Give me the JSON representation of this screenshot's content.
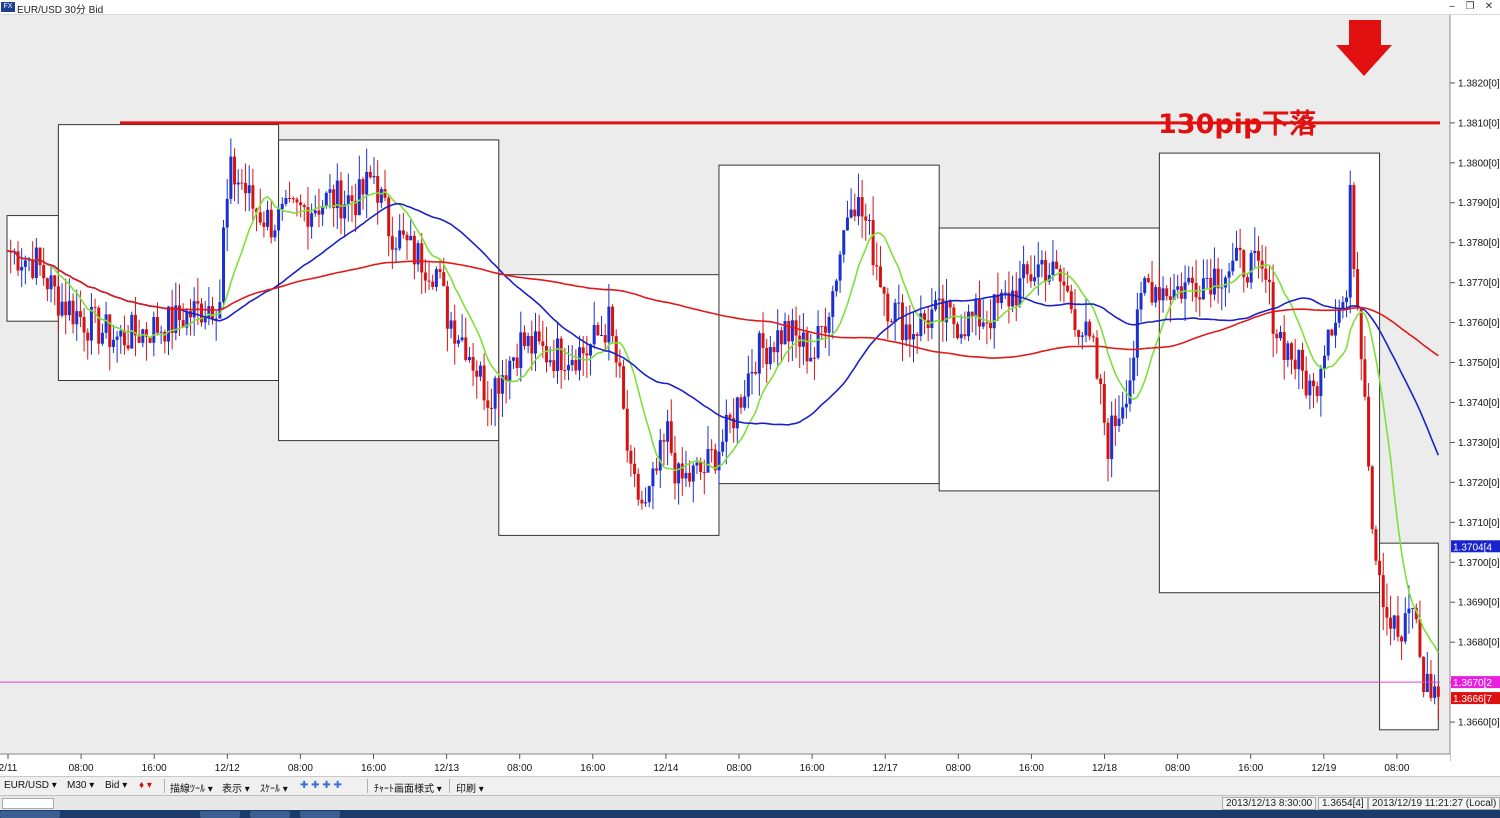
{
  "window": {
    "title": "EUR/USD 30分 Bid",
    "icon_label": "FX",
    "buttons": [
      {
        "name": "minimize-icon",
        "glyph": "–"
      },
      {
        "name": "restore-icon",
        "glyph": "❐"
      },
      {
        "name": "close-icon",
        "glyph": "✕"
      }
    ]
  },
  "chart_data": {
    "type": "candlestick",
    "symbol": "EUR/USD",
    "timeframe": "30分",
    "price_type": "Bid",
    "y_axis": {
      "range": [
        1.3652,
        1.3837
      ],
      "ticks": [
        "1.3820[0]",
        "1.3810[0]",
        "1.3800[0]",
        "1.3790[0]",
        "1.3780[0]",
        "1.3770[0]",
        "1.3760[0]",
        "1.3750[0]",
        "1.3740[0]",
        "1.3730[0]",
        "1.3720[0]",
        "1.3710[0]",
        "1.3700[0]",
        "1.3690[0]",
        "1.3680[0]",
        "1.3670[0]",
        "1.3660[0]"
      ]
    },
    "x_axis": {
      "ticks": [
        "2/11",
        "08:00",
        "16:00",
        "12/12",
        "08:00",
        "16:00",
        "12/13",
        "08:00",
        "16:00",
        "12/14",
        "08:00",
        "16:00",
        "12/17",
        "08:00",
        "16:00",
        "12/18",
        "08:00",
        "16:00",
        "12/19",
        "08:00"
      ]
    },
    "price_labels": [
      {
        "text": "1.3704[4",
        "value": 1.3704,
        "color": "#1a22cc"
      },
      {
        "text": "1.3670[2",
        "value": 1.367,
        "color": "#e81ee0"
      },
      {
        "text": "1.3666[7",
        "value": 1.3666,
        "color": "#e01010"
      }
    ],
    "horizontal_lines": [
      {
        "name": "resistance",
        "value": 1.381,
        "color": "#e21010"
      },
      {
        "name": "bid-line",
        "value": 1.367,
        "color": "#e040e0"
      }
    ],
    "annotation": {
      "text": "130pip下落",
      "color": "#e01010"
    },
    "arrow": {
      "direction": "down",
      "color": "#e21010"
    },
    "colors": {
      "up": "#1a30d0",
      "down": "#d41414",
      "ma_short": "#7ee03a",
      "ma_mid": "#1a22c8",
      "ma_long": "#e01a1a",
      "grid": "none"
    }
  },
  "toolbar": {
    "items": [
      {
        "label": "EUR/USD ▾",
        "name": "symbol-dropdown"
      },
      {
        "label": "M30 ▾",
        "name": "timeframe-dropdown"
      },
      {
        "label": "Bid ▾",
        "name": "price-type-dropdown"
      },
      {
        "label": "♦ ▾",
        "name": "color-dropdown"
      },
      {
        "label": "描線ﾂｰﾙ ▾",
        "name": "drawing-tools-menu"
      },
      {
        "label": "表示 ▾",
        "name": "display-menu"
      },
      {
        "label": "ｽｹｰﾙ ▾",
        "name": "scale-menu"
      },
      {
        "label": "✚ ✚ ✚ ✚",
        "name": "zoom-buttons"
      },
      {
        "label": "ﾁｬｰﾄ画面様式 ▾",
        "name": "chart-style-menu"
      },
      {
        "label": "印刷 ▾",
        "name": "print-menu"
      }
    ]
  },
  "status": {
    "cursor": "2013/12/13 8:30:00",
    "cursor_value": "1.3654[4]",
    "clock": "2013/12/19 11:21:27 (Local)"
  }
}
